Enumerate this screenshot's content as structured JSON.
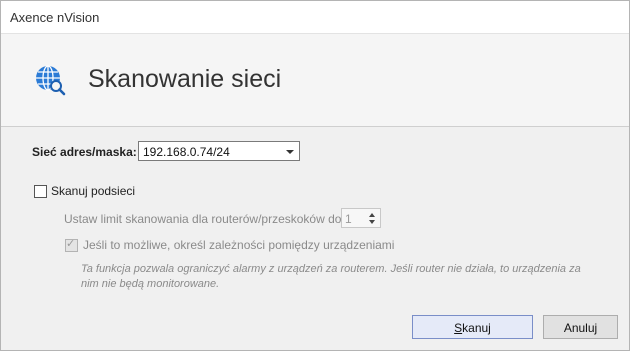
{
  "window": {
    "title": "Axence nVision"
  },
  "header": {
    "title": "Skanowanie sieci",
    "icon": "globe-search-icon"
  },
  "form": {
    "network_label": "Sieć adres/maska:",
    "network_value": "192.168.0.74/24",
    "scan_subnets_label": "Skanuj podsieci",
    "scan_subnets_checked": false,
    "limit_label": "Ustaw limit skanowania dla routerów/przeskoków do:",
    "limit_value": "1",
    "dependencies_label": "Jeśli to możliwe, określ zależności pomiędzy urządzeniami",
    "dependencies_checked": true,
    "note": "Ta funkcja pozwala ograniczyć alarmy z urządzeń za routerem. Jeśli router nie działa, to urządzenia za nim nie będą monitorowane."
  },
  "buttons": {
    "scan_prefix": "S",
    "scan_rest": "kanuj",
    "cancel": "Anuluj"
  },
  "colors": {
    "icon_blue": "#2b7bd6",
    "accent_border": "#7a8ec8"
  }
}
